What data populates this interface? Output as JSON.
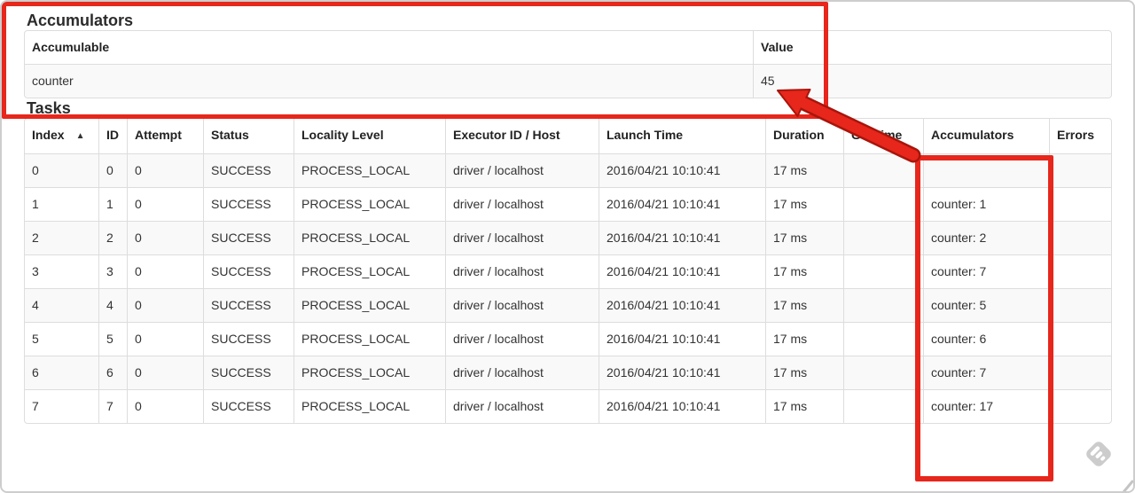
{
  "accumulators_section": {
    "title": "Accumulators",
    "table": {
      "headers": {
        "accumulable": "Accumulable",
        "value": "Value"
      },
      "row": {
        "accumulable": "counter",
        "value": "45"
      }
    }
  },
  "tasks_section": {
    "title": "Tasks",
    "table": {
      "sort_indicator": "▲",
      "columns": [
        {
          "key": "index",
          "label": "Index",
          "sorted": true
        },
        {
          "key": "id",
          "label": "ID"
        },
        {
          "key": "attempt",
          "label": "Attempt"
        },
        {
          "key": "status",
          "label": "Status"
        },
        {
          "key": "locality",
          "label": "Locality Level"
        },
        {
          "key": "executor",
          "label": "Executor ID / Host"
        },
        {
          "key": "launch_time",
          "label": "Launch Time"
        },
        {
          "key": "duration",
          "label": "Duration"
        },
        {
          "key": "gc_time",
          "label": "GC Time"
        },
        {
          "key": "accumulators",
          "label": "Accumulators"
        },
        {
          "key": "errors",
          "label": "Errors"
        }
      ],
      "rows": [
        {
          "index": "0",
          "id": "0",
          "attempt": "0",
          "status": "SUCCESS",
          "locality": "PROCESS_LOCAL",
          "executor": "driver / localhost",
          "launch_time": "2016/04/21 10:10:41",
          "duration": "17 ms",
          "gc_time": "",
          "accumulators": "",
          "errors": ""
        },
        {
          "index": "1",
          "id": "1",
          "attempt": "0",
          "status": "SUCCESS",
          "locality": "PROCESS_LOCAL",
          "executor": "driver / localhost",
          "launch_time": "2016/04/21 10:10:41",
          "duration": "17 ms",
          "gc_time": "",
          "accumulators": "counter: 1",
          "errors": ""
        },
        {
          "index": "2",
          "id": "2",
          "attempt": "0",
          "status": "SUCCESS",
          "locality": "PROCESS_LOCAL",
          "executor": "driver / localhost",
          "launch_time": "2016/04/21 10:10:41",
          "duration": "17 ms",
          "gc_time": "",
          "accumulators": "counter: 2",
          "errors": ""
        },
        {
          "index": "3",
          "id": "3",
          "attempt": "0",
          "status": "SUCCESS",
          "locality": "PROCESS_LOCAL",
          "executor": "driver / localhost",
          "launch_time": "2016/04/21 10:10:41",
          "duration": "17 ms",
          "gc_time": "",
          "accumulators": "counter: 7",
          "errors": ""
        },
        {
          "index": "4",
          "id": "4",
          "attempt": "0",
          "status": "SUCCESS",
          "locality": "PROCESS_LOCAL",
          "executor": "driver / localhost",
          "launch_time": "2016/04/21 10:10:41",
          "duration": "17 ms",
          "gc_time": "",
          "accumulators": "counter: 5",
          "errors": ""
        },
        {
          "index": "5",
          "id": "5",
          "attempt": "0",
          "status": "SUCCESS",
          "locality": "PROCESS_LOCAL",
          "executor": "driver / localhost",
          "launch_time": "2016/04/21 10:10:41",
          "duration": "17 ms",
          "gc_time": "",
          "accumulators": "counter: 6",
          "errors": ""
        },
        {
          "index": "6",
          "id": "6",
          "attempt": "0",
          "status": "SUCCESS",
          "locality": "PROCESS_LOCAL",
          "executor": "driver / localhost",
          "launch_time": "2016/04/21 10:10:41",
          "duration": "17 ms",
          "gc_time": "",
          "accumulators": "counter: 7",
          "errors": ""
        },
        {
          "index": "7",
          "id": "7",
          "attempt": "0",
          "status": "SUCCESS",
          "locality": "PROCESS_LOCAL",
          "executor": "driver / localhost",
          "launch_time": "2016/04/21 10:10:41",
          "duration": "17 ms",
          "gc_time": "",
          "accumulators": "counter: 17",
          "errors": ""
        }
      ]
    }
  },
  "annotations": {
    "highlight_color": "#e7261c",
    "watermark_color": "#cccccc"
  }
}
